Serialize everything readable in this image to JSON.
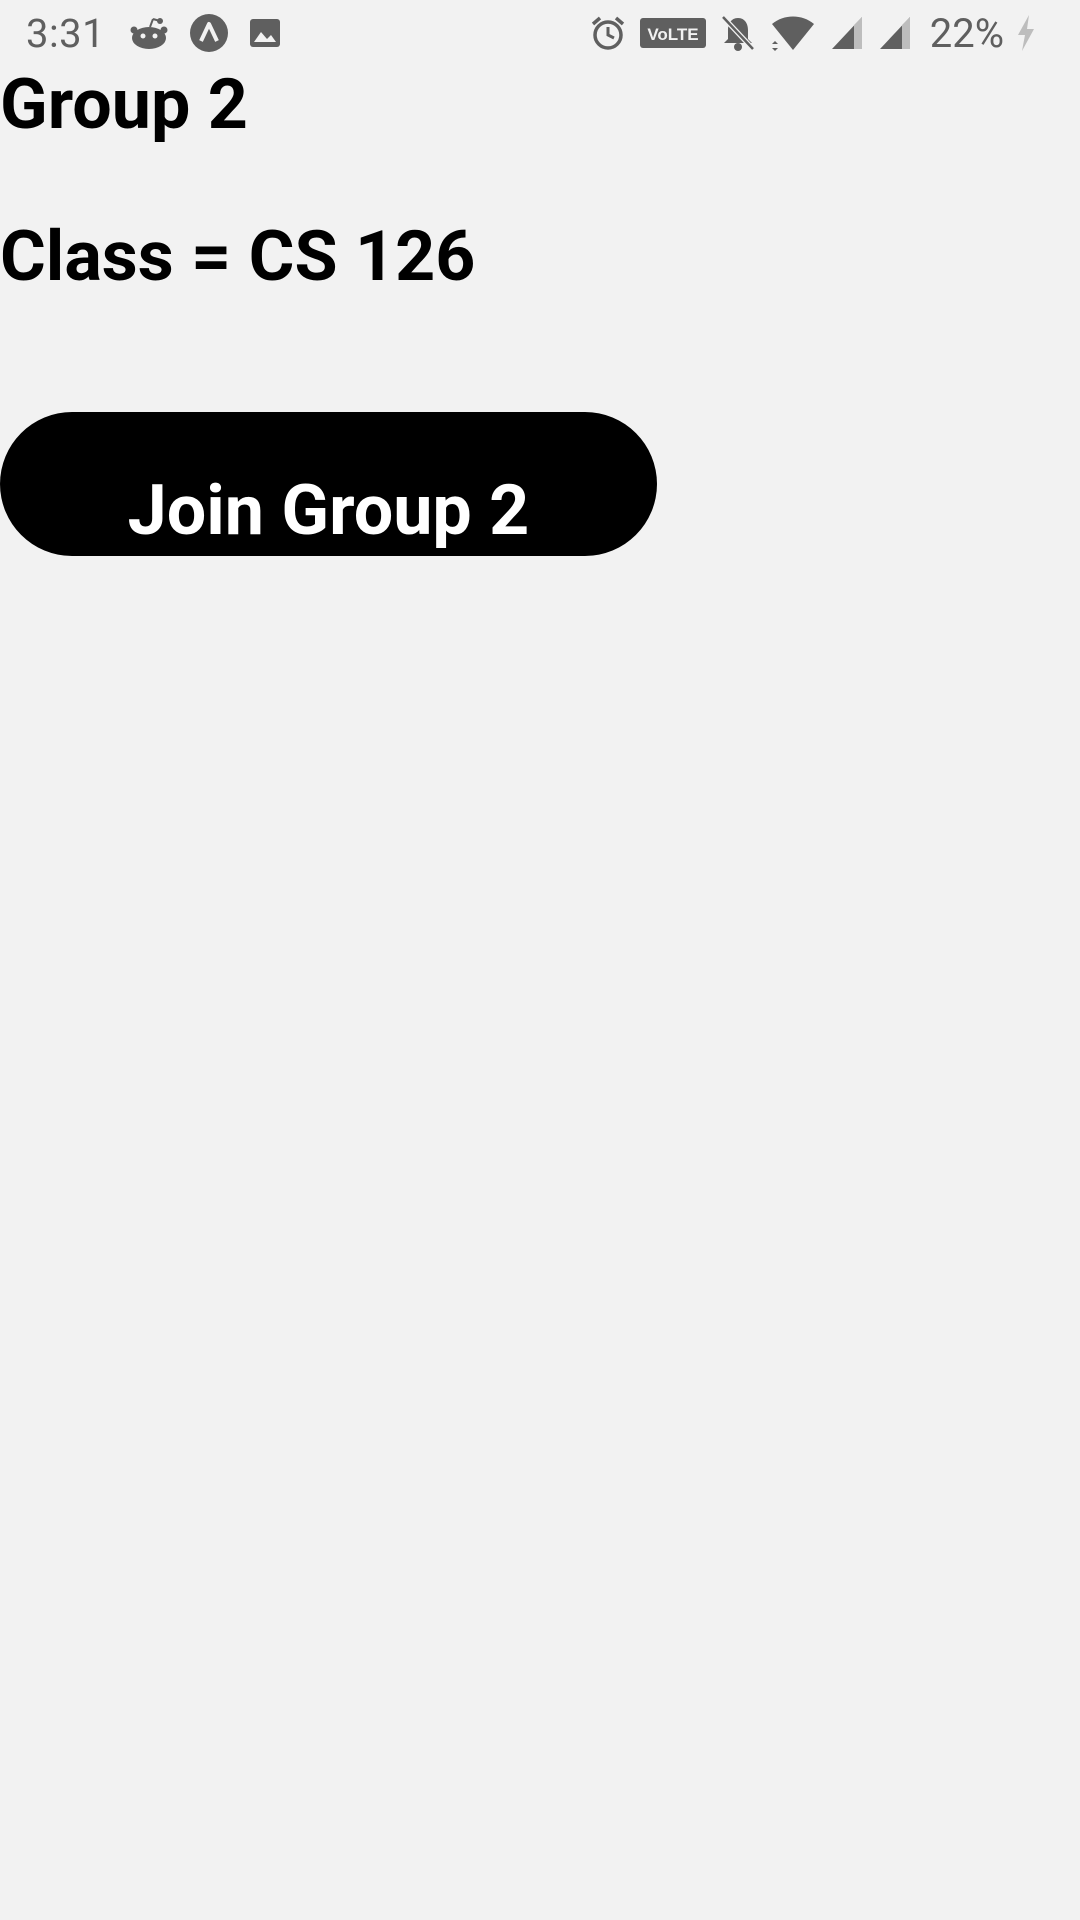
{
  "status_bar": {
    "time": "3:31",
    "battery_percent": "22%",
    "network_badge": "VoLTE",
    "left_icons": [
      "reddit-icon",
      "app-a-icon",
      "image-icon"
    ],
    "right_icons": [
      "alarm-icon",
      "volte-icon",
      "notifications-off-icon",
      "wifi-icon",
      "signal-icon",
      "signal-icon",
      "battery-charging-icon"
    ]
  },
  "group": {
    "title": "Group 2",
    "class_line": "Class = CS 126",
    "join_label": "Join Group 2"
  },
  "colors": {
    "background": "#f2f2f2",
    "text": "#000000",
    "button_bg": "#000000",
    "button_text": "#ffffff",
    "status_icons": "#5f5f5f"
  }
}
